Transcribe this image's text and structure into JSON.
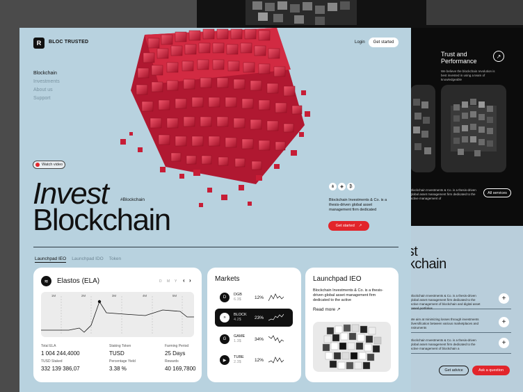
{
  "brand": {
    "name": "BLOC TRUSTED",
    "logo": "R"
  },
  "header": {
    "login": "Login",
    "get_started": "Get started"
  },
  "nav": [
    "Blockchain",
    "Investments",
    "About us",
    "Support"
  ],
  "hero": {
    "watch_video": "Watch video",
    "title_line1": "Invest",
    "title_line2": "Blockchain",
    "tag": "#Blockchain",
    "description": "Blockchain Investments & Co. is a thesis-driven global asset management firm dedicated",
    "cta": "Get started",
    "cta_icon": "↗"
  },
  "tabs": [
    "Launchpad IEO",
    "Launchpad IDO",
    "Token"
  ],
  "elastos": {
    "title": "Elastos (ELA)",
    "timeframes": [
      "D",
      "M",
      "Y"
    ],
    "chart_labels": [
      "1M",
      "2M",
      "3M",
      "4M",
      "5M"
    ],
    "stats": [
      {
        "label": "Total ELA",
        "value": "1 004 244,4000"
      },
      {
        "label": "Staking Token",
        "value": "TUSD"
      },
      {
        "label": "Farming Period",
        "value": "25 Days"
      },
      {
        "label": "TUSD Staked",
        "value": "332 139 386,07"
      },
      {
        "label": "Percentage Yield",
        "value": "3.38 %"
      },
      {
        "label": "Rewards",
        "value": "40 169,7800"
      }
    ]
  },
  "markets": {
    "title": "Markets",
    "items": [
      {
        "name": "DGB",
        "price": "6.3$",
        "pct": "12%",
        "icon": "D"
      },
      {
        "name": "BLOCK",
        "price": "4.2$",
        "pct": "23%",
        "icon": "»"
      },
      {
        "name": "GAME",
        "price": "1.3$",
        "pct": "34%",
        "icon": "G"
      },
      {
        "name": "TUBE",
        "price": "2.3$",
        "pct": "12%",
        "icon": "▶"
      }
    ]
  },
  "launchpad": {
    "title": "Launchpad IEO",
    "description": "Blockchain Investments & Co. is a thesis-driven global asset management firm dedicated to the active",
    "read_more": "Read more",
    "read_more_icon": "↗"
  },
  "right_panel": {
    "title": "Trust and Performance",
    "arrow": "↗",
    "description": "We believe the blockchain revolution is best invested in using a team of knowledgeable",
    "footer_text": "Blockchain Investments & Co. is a thesis-driven global asset management firm dedicated to the active management of",
    "all_services": "All services"
  },
  "bottom_panel": {
    "title_line1": "Invest",
    "title_line2": "Blockchain",
    "items": [
      "Blockchain Investments & Co. is a thesis-driven global asset management firm dedicated to the active management of blockchain and digital asset based portfolios",
      "We aim at minimizing losses through investments diversification between various marketplaces and instruments",
      "Blockchain Investments & Co. is a thesis-driven global asset management firm dedicated to the active management of blockchain a"
    ],
    "get_advice": "Get advice",
    "ask_question": "Ask a question"
  },
  "colors": {
    "accent": "#e2252b",
    "card_bg": "#b8d2df",
    "dark": "#111111"
  }
}
